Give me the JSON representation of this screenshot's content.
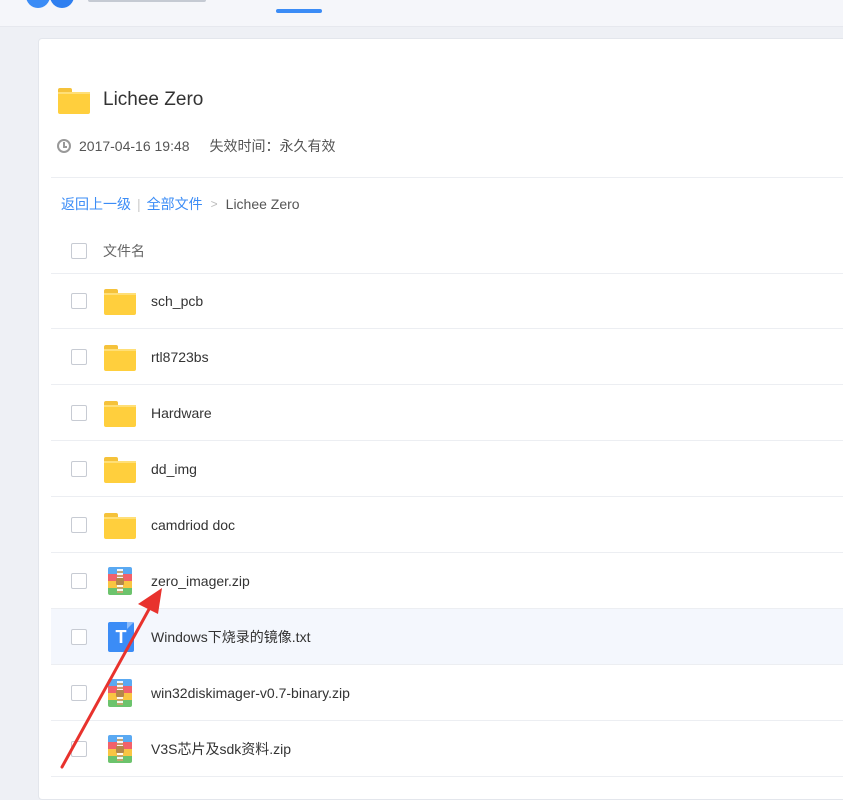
{
  "share": {
    "title": "Lichee Zero",
    "date": "2017-04-16 19:48",
    "expire": "失效时间：永久有效"
  },
  "breadcrumb": {
    "back": "返回上一级",
    "separator": "|",
    "all_files": "全部文件",
    "arrow": ">",
    "current": "Lichee Zero"
  },
  "list_header": {
    "name_col": "文件名"
  },
  "files": [
    {
      "name": "sch_pcb",
      "type": "folder-icon"
    },
    {
      "name": "rtl8723bs",
      "type": "folder-icon"
    },
    {
      "name": "Hardware",
      "type": "folder-icon"
    },
    {
      "name": "dd_img",
      "type": "folder-icon"
    },
    {
      "name": "camdriod doc",
      "type": "folder-icon"
    },
    {
      "name": "zero_imager.zip",
      "type": "zip-icon"
    },
    {
      "name": "Windows下烧录的镜像.txt",
      "type": "txt-icon"
    },
    {
      "name": "win32diskimager-v0.7-binary.zip",
      "type": "zip-icon"
    },
    {
      "name": "V3S芯片及sdk资料.zip",
      "type": "zip-icon"
    }
  ],
  "colors": {
    "accent": "#3b8cf6",
    "annotation_arrow": "#e8322d"
  }
}
